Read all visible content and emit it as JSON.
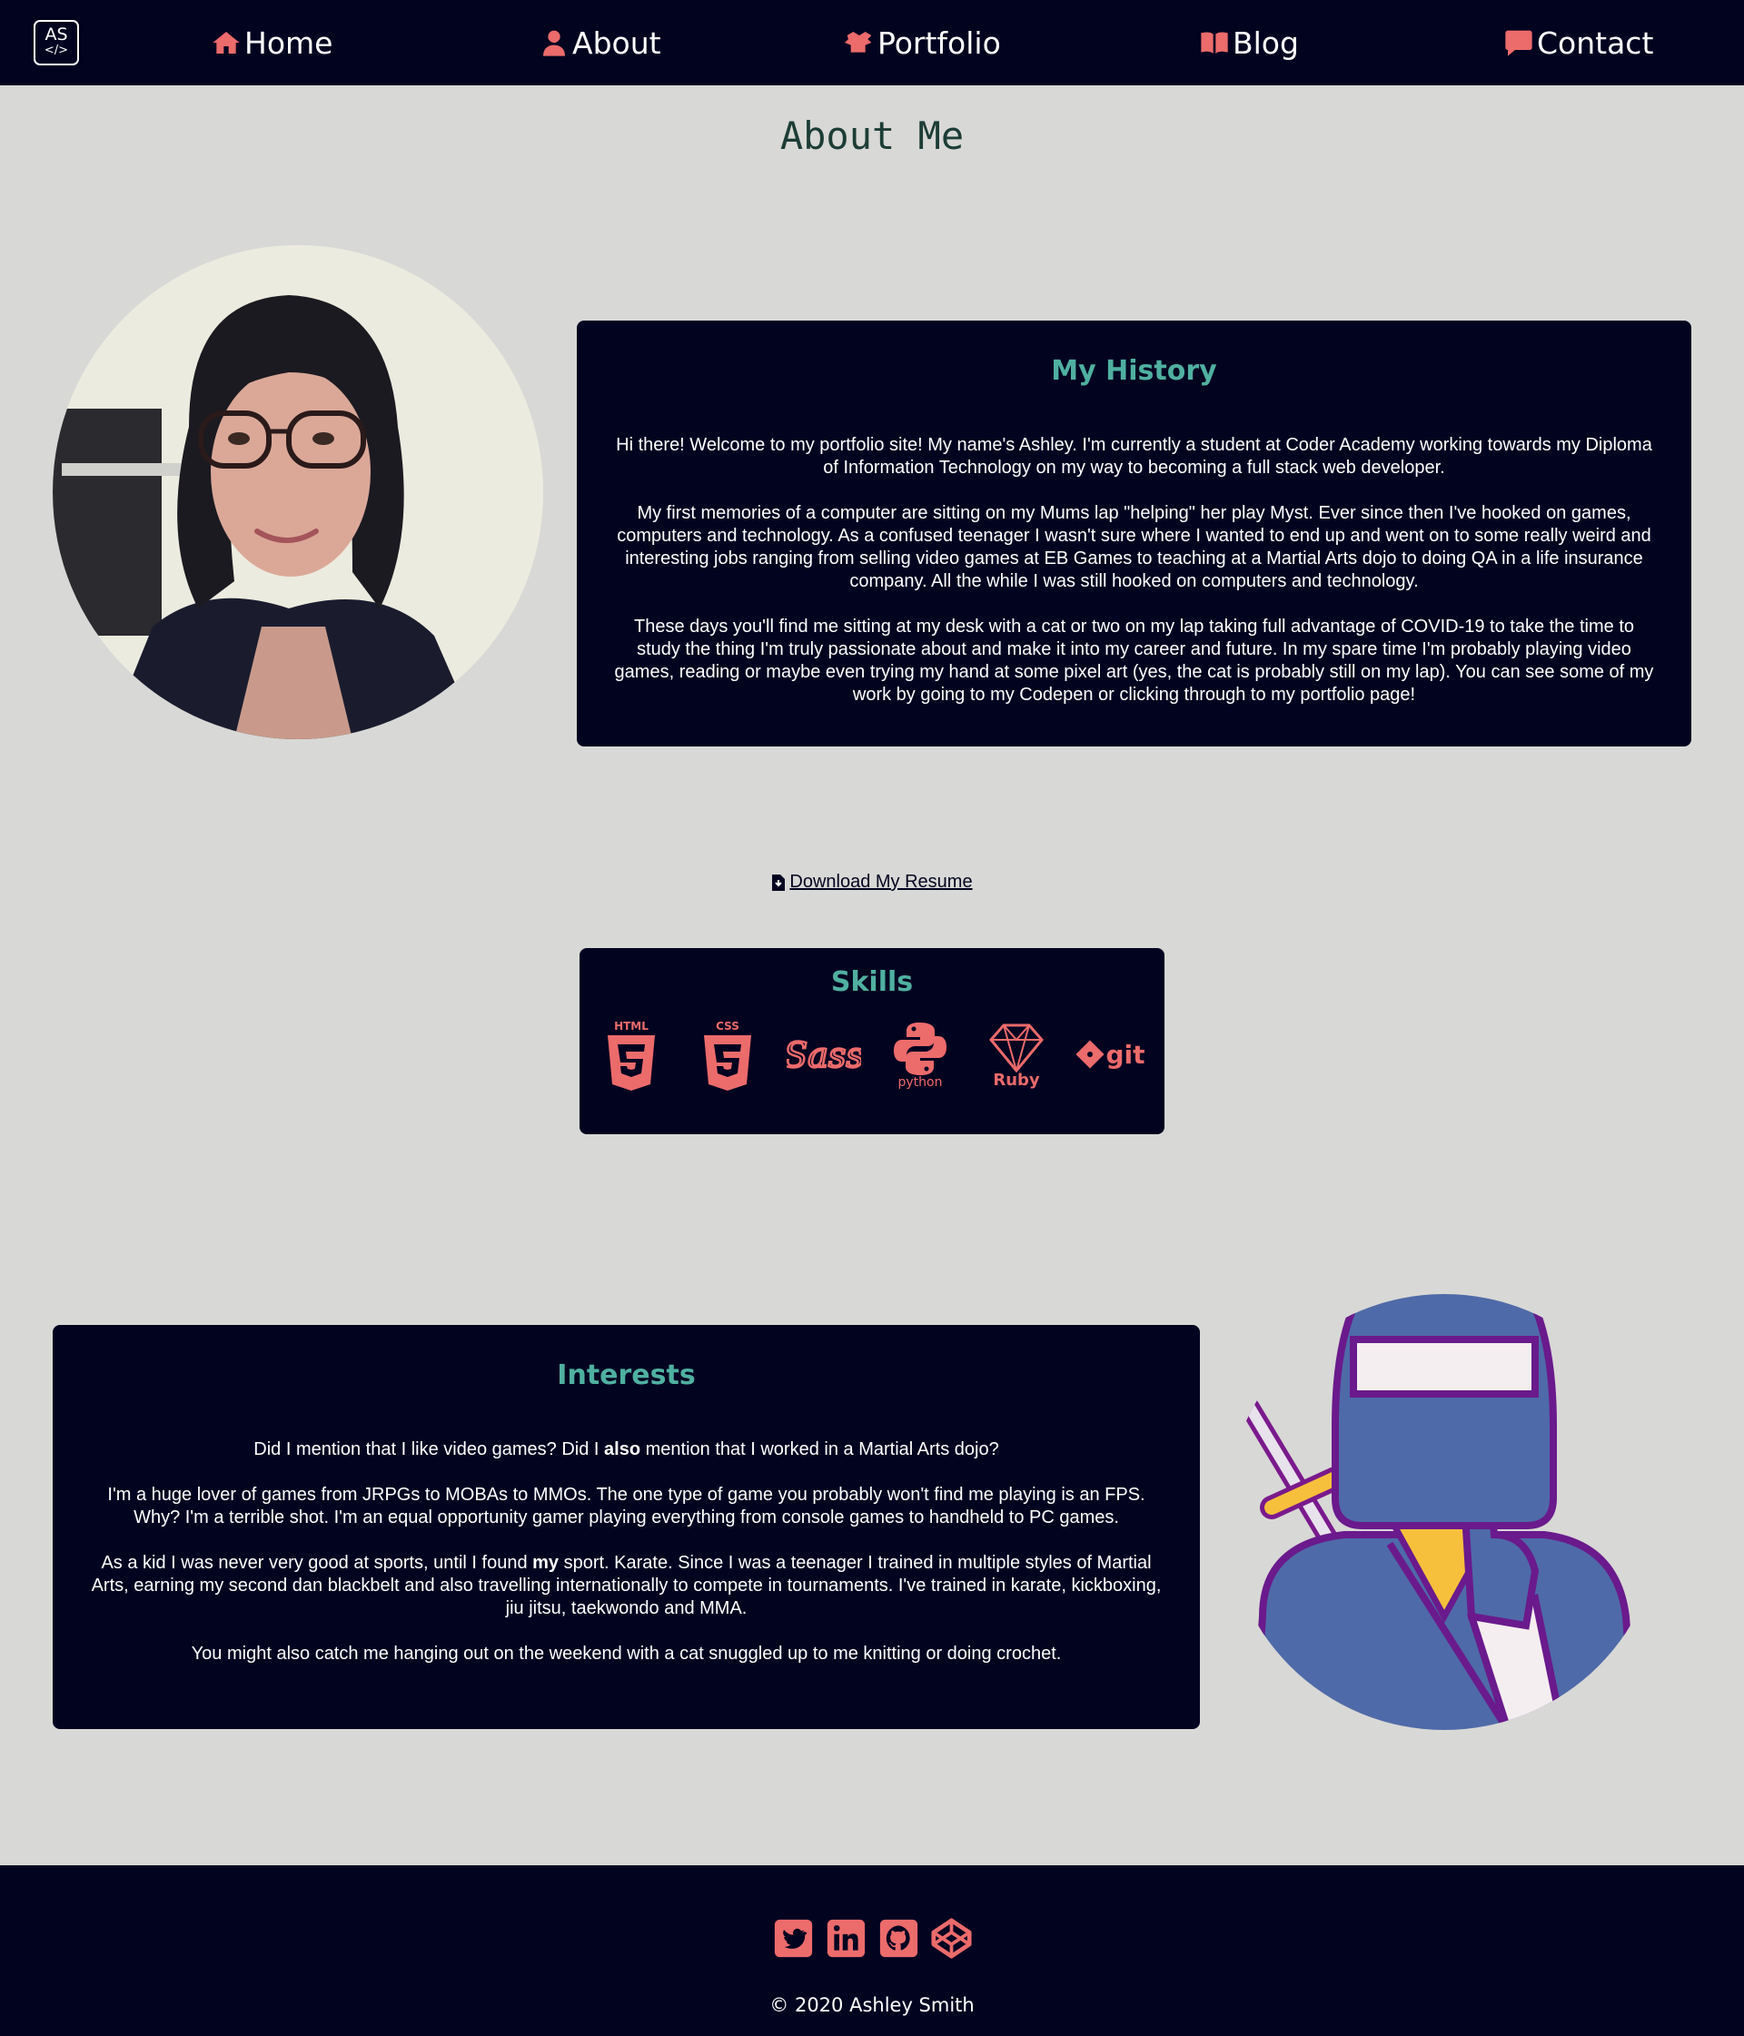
{
  "nav": {
    "logo_line1": "AS",
    "logo_line2": "</>",
    "items": [
      {
        "label": "Home",
        "icon": "home-icon"
      },
      {
        "label": "About",
        "icon": "user-icon"
      },
      {
        "label": "Portfolio",
        "icon": "box-icon"
      },
      {
        "label": "Blog",
        "icon": "book-icon"
      },
      {
        "label": "Contact",
        "icon": "comment-icon"
      }
    ]
  },
  "page_title": "About Me",
  "history": {
    "title": "My History",
    "paragraphs": [
      "Hi there! Welcome to my portfolio site! My name's Ashley. I'm currently a student at Coder Academy working towards my Diploma of Information Technology on my way to becoming a full stack web developer.",
      "My first memories of a computer are sitting on my Mums lap \"helping\" her play Myst. Ever since then I've hooked on games, computers and technology. As a confused teenager I wasn't sure where I wanted to end up and went on to some really weird and interesting jobs ranging from selling video games at EB Games to teaching at a Martial Arts dojo to doing QA in a life insurance company. All the while I was still hooked on computers and technology.",
      "These days you'll find me sitting at my desk with a cat or two on my lap taking full advantage of COVID-19 to take the time to study the thing I'm truly passionate about and make it into my career and future. In my spare time I'm probably playing video games, reading or maybe even trying my hand at some pixel art (yes, the cat is probably still on my lap). You can see some of my work by going to my Codepen or clicking through to my portfolio page!"
    ]
  },
  "resume_link": "Download My Resume",
  "skills": {
    "title": "Skills",
    "items": [
      {
        "name": "HTML5",
        "icon": "html5-icon",
        "label": "HTML"
      },
      {
        "name": "CSS3",
        "icon": "css3-icon",
        "label": "CSS"
      },
      {
        "name": "Sass",
        "icon": "sass-icon",
        "label": "Sass"
      },
      {
        "name": "Python",
        "icon": "python-icon",
        "label": "python"
      },
      {
        "name": "Ruby",
        "icon": "ruby-icon",
        "label": "Ruby"
      },
      {
        "name": "Git",
        "icon": "git-icon",
        "label": "git"
      }
    ]
  },
  "interests": {
    "title": "Interests",
    "p1_before": "Did I mention that I like video games? Did I ",
    "p1_bold": "also",
    "p1_after": " mention that I worked in a Martial Arts dojo?",
    "p2": "I'm a huge lover of games from JRPGs to MOBAs to MMOs. The one type of game you probably won't find me playing is an FPS. Why? I'm a terrible shot. I'm an equal opportunity gamer playing everything from console games to handheld to PC games.",
    "p3_before": "As a kid I was never very good at sports, until I found ",
    "p3_bold": "my",
    "p3_after": " sport. Karate. Since I was a teenager I trained in multiple styles of Martial Arts, earning my second dan blackbelt and also travelling internationally to compete in tournaments. I've trained in karate, kickboxing, jiu jitsu, taekwondo and MMA.",
    "p4": "You might also catch me hanging out on the weekend with a cat snuggled up to me knitting or doing crochet."
  },
  "footer": {
    "social": [
      "twitter-icon",
      "linkedin-icon",
      "github-icon",
      "codepen-icon"
    ],
    "copyright": "© 2020 Ashley Smith"
  },
  "colors": {
    "navy": "#02031f",
    "accent": "#ec6b6b",
    "teal": "#4fb0a0",
    "background": "#d8d8d6",
    "title": "#1c3d36"
  }
}
